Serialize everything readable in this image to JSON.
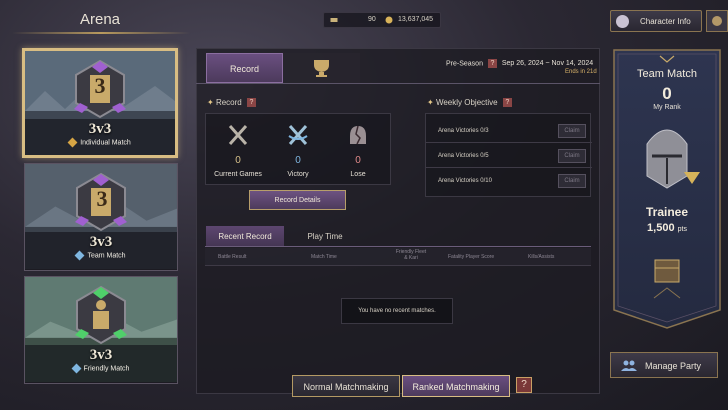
{
  "header": {
    "title": "Arena",
    "currency_1": "90",
    "currency_2": "13,637,045",
    "character_info": "Character Info"
  },
  "modes": [
    {
      "rank_digit": "3",
      "label": "3v3",
      "sub": "Individual Match",
      "gem_color": "#d6a544",
      "accent": "#a060d0",
      "selected": true
    },
    {
      "rank_digit": "3",
      "label": "3v3",
      "sub": "Team Match",
      "gem_color": "#7fb6e0",
      "accent": "#a060d0",
      "selected": false
    },
    {
      "rank_digit": "",
      "label": "3v3",
      "sub": "Friendly Match",
      "gem_color": "#7fb6e0",
      "accent": "#4fcf6a",
      "selected": false
    }
  ],
  "tabs": {
    "record": "Record",
    "trophy_icon": "trophy-icon"
  },
  "season": {
    "name": "Pre-Season",
    "range": "Sep 26, 2024 ~ Nov 14, 2024",
    "ends": "Ends in 21d"
  },
  "record": {
    "header": "Record",
    "stats": [
      {
        "value": "0",
        "label": "Current Games",
        "color": "#d6c08a"
      },
      {
        "value": "0",
        "label": "Victory",
        "color": "#7fb6e0"
      },
      {
        "value": "0",
        "label": "Lose",
        "color": "#e08a8a"
      }
    ],
    "details_button": "Record Details"
  },
  "weekly": {
    "header": "Weekly Objective",
    "items": [
      {
        "text": "Arena Victories 0/3",
        "claim": "Claim"
      },
      {
        "text": "Arena Victories 0/5",
        "claim": "Claim"
      },
      {
        "text": "Arena Victories 0/10",
        "claim": "Claim"
      }
    ]
  },
  "recent": {
    "tab_recent": "Recent Record",
    "tab_playtime": "Play Time",
    "columns": [
      "Battle Result",
      "Match Time",
      "Friendly Fleet & Kari",
      "Fatality Player Score",
      "Kills/Assists"
    ],
    "empty": "You have no recent matches."
  },
  "banner": {
    "title": "Team Match",
    "rank": "0",
    "rank_label": "My Rank",
    "tier": "Trainee",
    "points": "1,500",
    "points_unit": "pts"
  },
  "buttons": {
    "manage_party": "Manage Party",
    "normal": "Normal Matchmaking",
    "ranked": "Ranked Matchmaking",
    "help": "?"
  }
}
